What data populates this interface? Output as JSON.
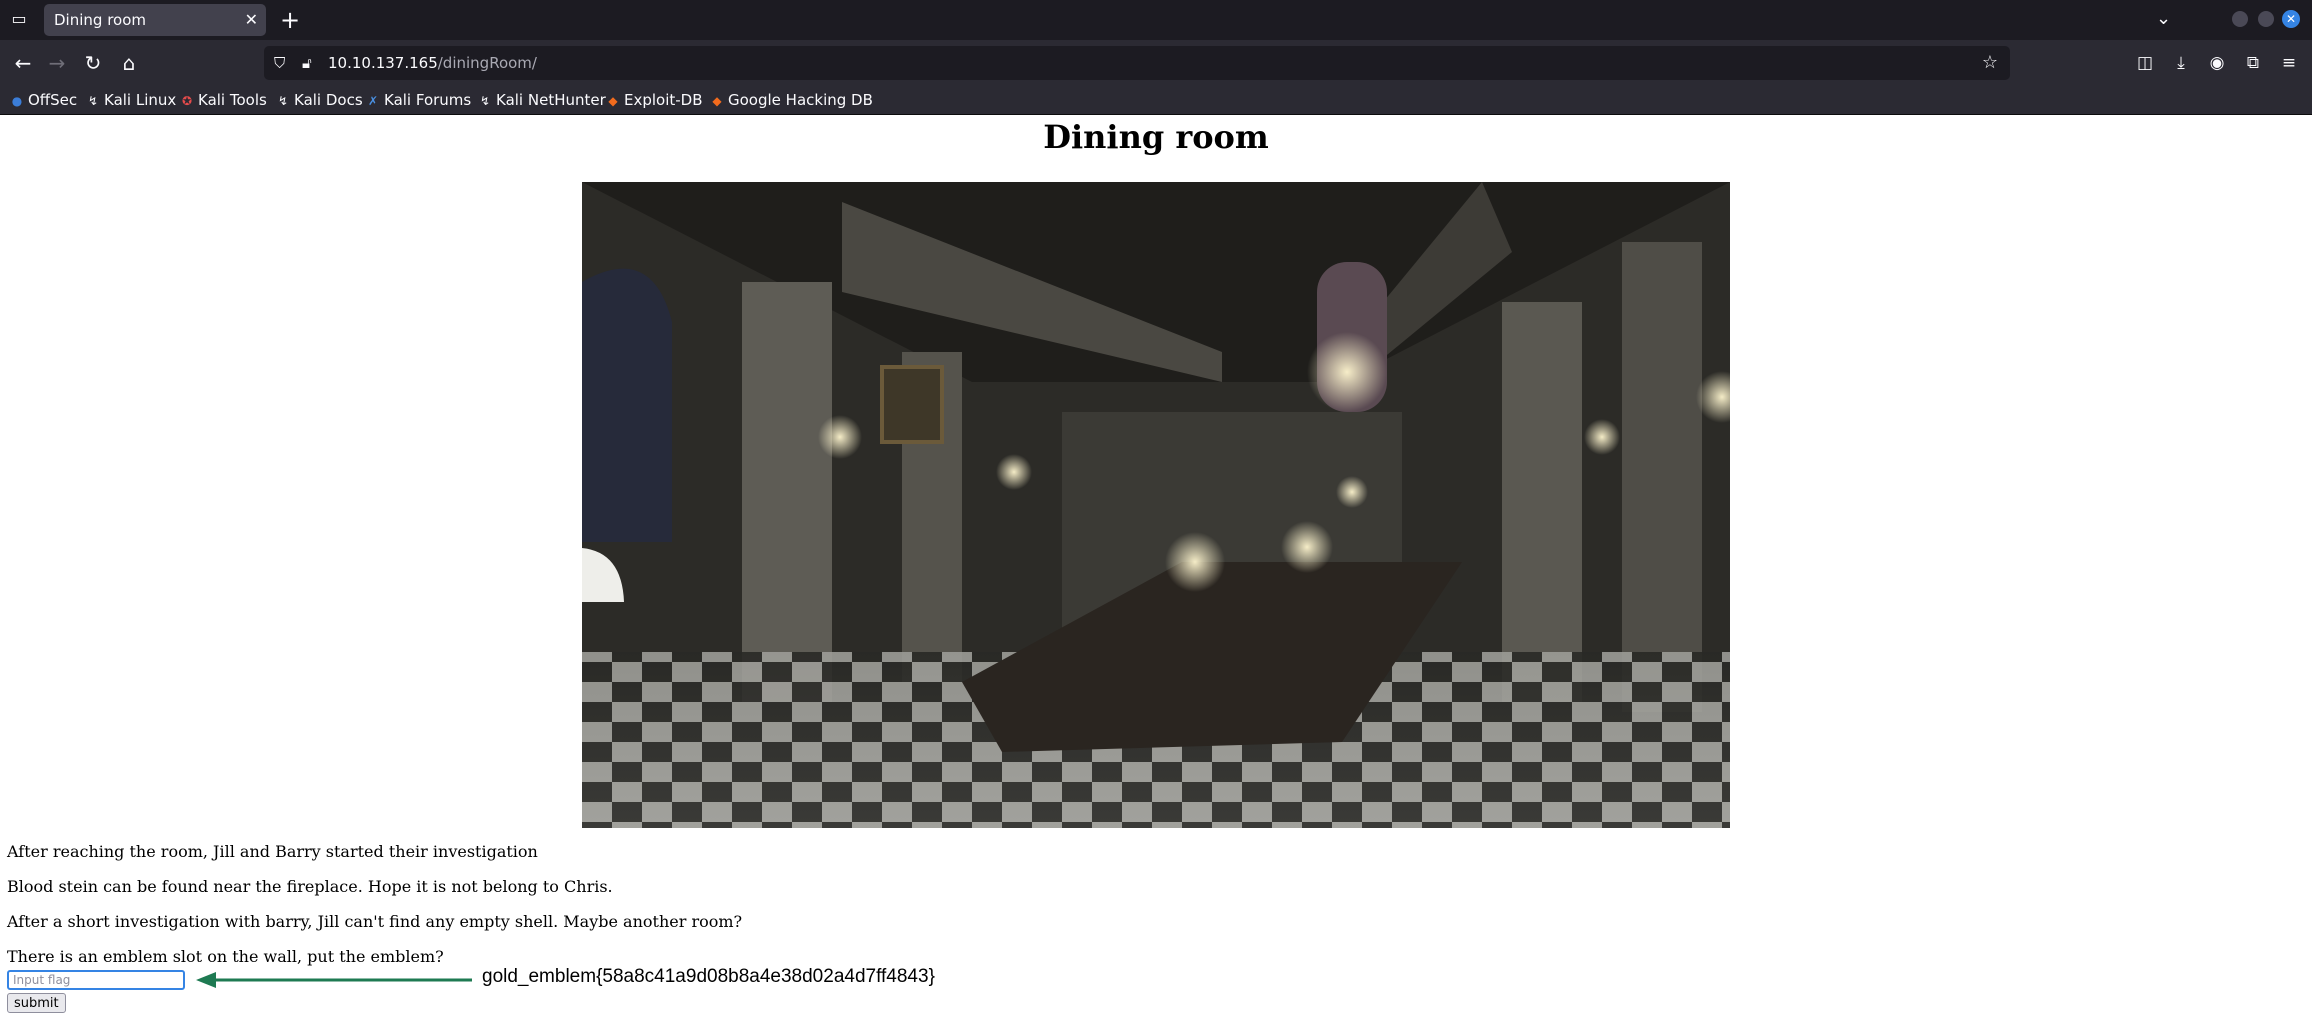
{
  "browser": {
    "tab": {
      "title": "Dining room",
      "close_glyph": "✕"
    },
    "new_tab_glyph": "+",
    "url": {
      "host": "10.10.137.165",
      "path": "/diningRoom/"
    },
    "bookmarks": [
      {
        "label": "OffSec",
        "icon": "offsec-icon"
      },
      {
        "label": "Kali Linux",
        "icon": "kali-dragon-icon"
      },
      {
        "label": "Kali Tools",
        "icon": "kali-tools-icon"
      },
      {
        "label": "Kali Docs",
        "icon": "kali-dragon-icon"
      },
      {
        "label": "Kali Forums",
        "icon": "kali-forums-icon"
      },
      {
        "label": "Kali NetHunter",
        "icon": "kali-dragon-icon"
      },
      {
        "label": "Exploit-DB",
        "icon": "exploit-db-icon"
      },
      {
        "label": "Google Hacking DB",
        "icon": "ghdb-icon"
      }
    ],
    "colors": {
      "tabbar": "#1c1b22",
      "toolbar": "#2b2a33",
      "accent": "#3584e4"
    }
  },
  "page": {
    "title": "Dining room",
    "paragraphs": [
      "After reaching the room, Jill and Barry started their investigation",
      "Blood stein can be found near the fireplace. Hope it is not belong to Chris.",
      "After a short investigation with barry, Jill can't find any empty shell. Maybe another room?",
      "There is an emblem slot on the wall, put the emblem?"
    ],
    "form": {
      "input_placeholder": "Input flag",
      "input_value": "",
      "submit_label": "submit"
    },
    "annotation": {
      "text": "gold_emblem{58a8c41a9d08b8a4e38d02a4d7ff4843}",
      "color": "#1e7a52"
    }
  }
}
